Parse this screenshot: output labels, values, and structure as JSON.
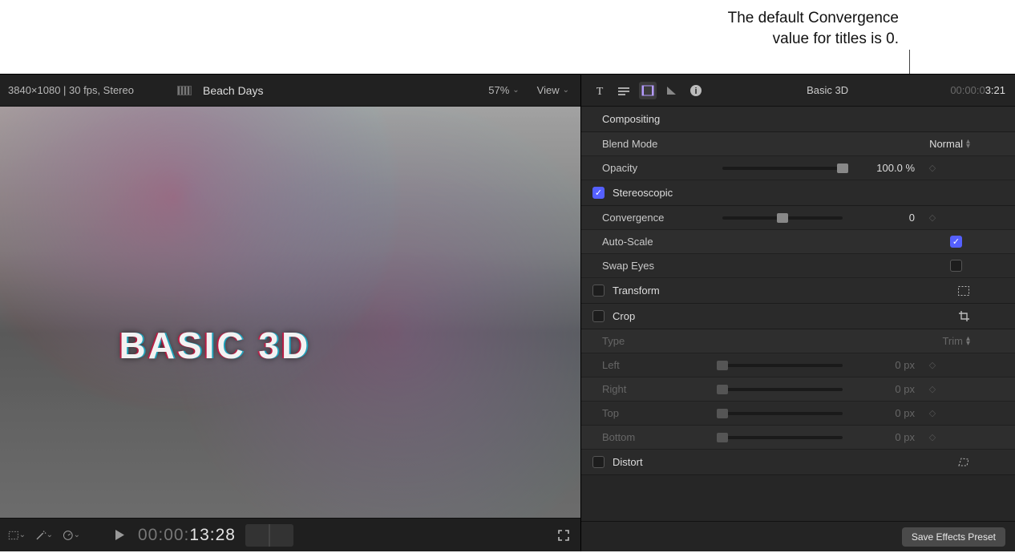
{
  "annotation": {
    "line1": "The default Convergence",
    "line2": "value for titles is 0."
  },
  "viewer": {
    "info": "3840×1080 | 30 fps, Stereo",
    "clip_name": "Beach Days",
    "zoom": "57%",
    "view_label": "View",
    "title_overlay": "BASIC 3D",
    "footer_tc_dim": "00:00:",
    "footer_tc_bright": "13:28"
  },
  "inspector": {
    "clip_name": "Basic 3D",
    "tc_dim": "00:00:0",
    "tc_bright": "3:21",
    "compositing": {
      "heading": "Compositing",
      "blend_mode_label": "Blend Mode",
      "blend_mode_value": "Normal",
      "opacity_label": "Opacity",
      "opacity_value": "100.0 %"
    },
    "stereoscopic": {
      "heading": "Stereoscopic",
      "enabled": true,
      "convergence_label": "Convergence",
      "convergence_value": "0",
      "autoscale_label": "Auto-Scale",
      "autoscale_checked": true,
      "swapeyes_label": "Swap Eyes",
      "swapeyes_checked": false
    },
    "transform": {
      "heading": "Transform",
      "enabled": false
    },
    "crop": {
      "heading": "Crop",
      "enabled": false,
      "type_label": "Type",
      "type_value": "Trim",
      "left_label": "Left",
      "left_value": "0 px",
      "right_label": "Right",
      "right_value": "0 px",
      "top_label": "Top",
      "top_value": "0 px",
      "bottom_label": "Bottom",
      "bottom_value": "0 px"
    },
    "distort": {
      "heading": "Distort",
      "enabled": false
    },
    "save_preset": "Save Effects Preset"
  }
}
